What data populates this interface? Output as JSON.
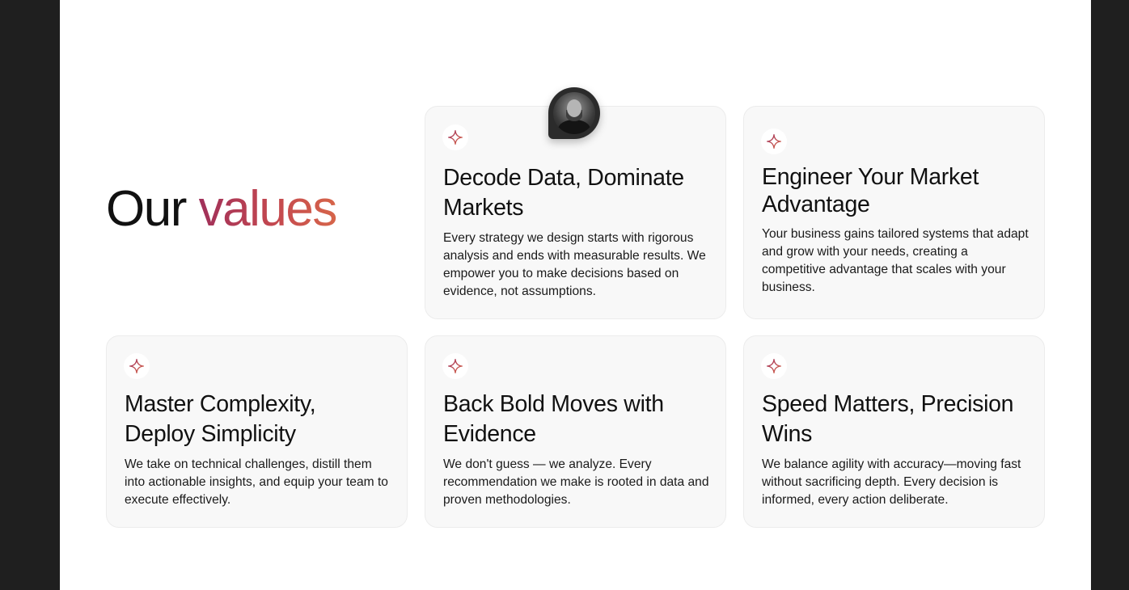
{
  "section": {
    "heading_prefix": "Our",
    "heading_accent": "values"
  },
  "accent_colors": [
    "#a0305a",
    "#c4484f",
    "#d6654a"
  ],
  "icon": "sparkle-icon",
  "cards": [
    {
      "title": "Decode Data, Dominate Markets",
      "body": "Every strategy we design starts with rigorous analysis and ends with measurable results. We empower you to make decisions based on evidence, not assumptions."
    },
    {
      "title": "Engineer Your Market Advantage",
      "body": "Your business gains tailored systems that adapt and grow with your needs, creating a competitive advantage that scales with your business."
    },
    {
      "title": "Master Complexity, Deploy Simplicity",
      "body": "We take on technical challenges, distill them into actionable insights, and equip your team to execute effectively."
    },
    {
      "title": "Back Bold Moves with Evidence",
      "body": "We don't guess — we analyze. Every recommendation we make is rooted in data and proven methodologies."
    },
    {
      "title": "Speed Matters, Precision Wins",
      "body": "We balance agility with accuracy—moving fast without sacrificing depth. Every decision is informed, every action deliberate."
    }
  ]
}
